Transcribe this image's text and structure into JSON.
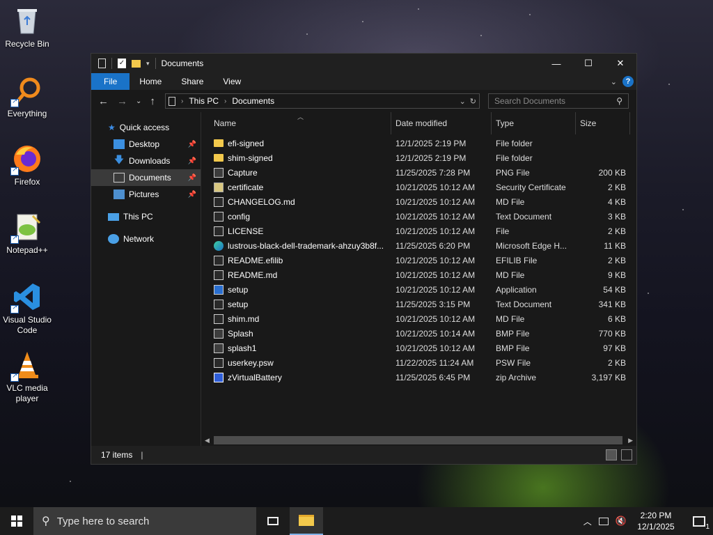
{
  "desktop": {
    "icons": [
      {
        "label": "Recycle Bin"
      },
      {
        "label": "Everything"
      },
      {
        "label": "Firefox"
      },
      {
        "label": "Notepad++"
      },
      {
        "label": "Visual Studio Code"
      },
      {
        "label": "VLC media player"
      }
    ]
  },
  "window": {
    "title": "Documents",
    "buttons": {
      "minimize": "—",
      "maximize": "☐",
      "close": "✕"
    },
    "ribbon_tabs": [
      "File",
      "Home",
      "Share",
      "View"
    ],
    "address": {
      "root": "This PC",
      "current": "Documents"
    },
    "search_placeholder": "Search Documents",
    "nav_pane": [
      {
        "label": "Quick access",
        "icon": "star-icon",
        "pinned": false
      },
      {
        "label": "Desktop",
        "icon": "desktop-folder-icon",
        "pinned": true
      },
      {
        "label": "Downloads",
        "icon": "download-arrow-icon",
        "pinned": true
      },
      {
        "label": "Documents",
        "icon": "documents-folder-icon",
        "pinned": true,
        "selected": true
      },
      {
        "label": "Pictures",
        "icon": "pictures-folder-icon",
        "pinned": true
      },
      {
        "label": "This PC",
        "icon": "computer-icon",
        "pinned": false
      },
      {
        "label": "Network",
        "icon": "network-icon",
        "pinned": false
      }
    ],
    "columns": {
      "name": "Name",
      "date": "Date modified",
      "type": "Type",
      "size": "Size"
    },
    "files": [
      {
        "name": "efi-signed",
        "date": "12/1/2025 2:19 PM",
        "type": "File folder",
        "size": "",
        "icon": "folder"
      },
      {
        "name": "shim-signed",
        "date": "12/1/2025 2:19 PM",
        "type": "File folder",
        "size": "",
        "icon": "folder"
      },
      {
        "name": "Capture",
        "date": "11/25/2025 7:28 PM",
        "type": "PNG File",
        "size": "200 KB",
        "icon": "img"
      },
      {
        "name": "certificate",
        "date": "10/21/2025 10:12 AM",
        "type": "Security Certificate",
        "size": "2 KB",
        "icon": "cert"
      },
      {
        "name": "CHANGELOG.md",
        "date": "10/21/2025 10:12 AM",
        "type": "MD File",
        "size": "4 KB",
        "icon": "doc"
      },
      {
        "name": "config",
        "date": "10/21/2025 10:12 AM",
        "type": "Text Document",
        "size": "3 KB",
        "icon": "doc"
      },
      {
        "name": "LICENSE",
        "date": "10/21/2025 10:12 AM",
        "type": "File",
        "size": "2 KB",
        "icon": "doc"
      },
      {
        "name": "lustrous-black-dell-trademark-ahzuy3b8f...",
        "date": "11/25/2025 6:20 PM",
        "type": "Microsoft Edge H...",
        "size": "11 KB",
        "icon": "edge"
      },
      {
        "name": "README.efilib",
        "date": "10/21/2025 10:12 AM",
        "type": "EFILIB File",
        "size": "2 KB",
        "icon": "doc"
      },
      {
        "name": "README.md",
        "date": "10/21/2025 10:12 AM",
        "type": "MD File",
        "size": "9 KB",
        "icon": "doc"
      },
      {
        "name": "setup",
        "date": "10/21/2025 10:12 AM",
        "type": "Application",
        "size": "54 KB",
        "icon": "app"
      },
      {
        "name": "setup",
        "date": "11/25/2025 3:15 PM",
        "type": "Text Document",
        "size": "341 KB",
        "icon": "doc"
      },
      {
        "name": "shim.md",
        "date": "10/21/2025 10:12 AM",
        "type": "MD File",
        "size": "6 KB",
        "icon": "doc"
      },
      {
        "name": "Splash",
        "date": "10/21/2025 10:14 AM",
        "type": "BMP File",
        "size": "770 KB",
        "icon": "img"
      },
      {
        "name": "splash1",
        "date": "10/21/2025 10:12 AM",
        "type": "BMP File",
        "size": "97 KB",
        "icon": "img"
      },
      {
        "name": "userkey.psw",
        "date": "11/22/2025 11:24 AM",
        "type": "PSW File",
        "size": "2 KB",
        "icon": "doc"
      },
      {
        "name": "zVirtualBattery",
        "date": "11/25/2025 6:45 PM",
        "type": "zip Archive",
        "size": "3,197 KB",
        "icon": "zip"
      }
    ],
    "status": {
      "items": "17 items",
      "cursor": "|"
    }
  },
  "taskbar": {
    "search_placeholder": "Type here to search",
    "clock": {
      "time": "2:20 PM",
      "date": "12/1/2025"
    },
    "notification_count": "1"
  }
}
